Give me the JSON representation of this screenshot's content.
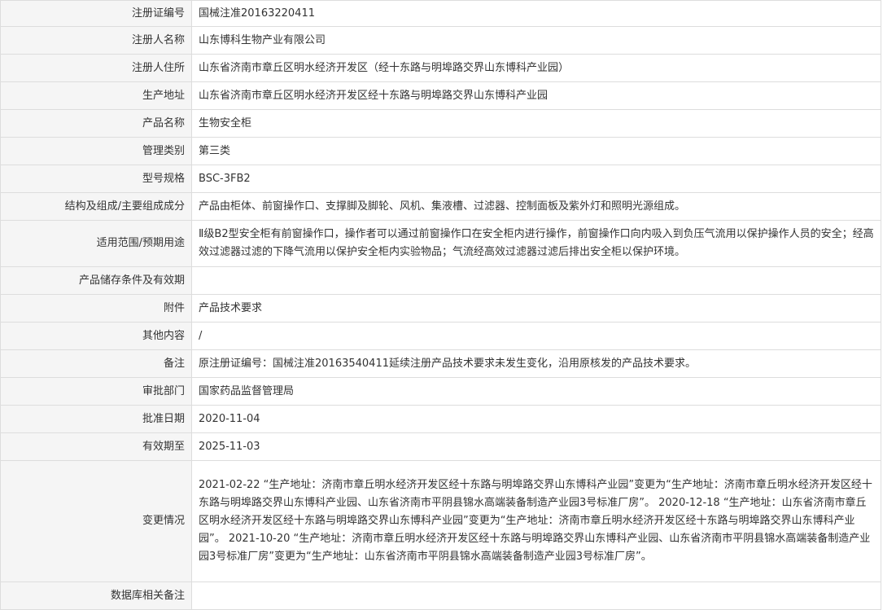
{
  "rows": [
    {
      "label": "注册证编号",
      "value": "国械注准20163220411"
    },
    {
      "label": "注册人名称",
      "value": "山东博科生物产业有限公司"
    },
    {
      "label": "注册人住所",
      "value": "山东省济南市章丘区明水经济开发区（经十东路与明埠路交界山东博科产业园）"
    },
    {
      "label": "生产地址",
      "value": "山东省济南市章丘区明水经济开发区经十东路与明埠路交界山东博科产业园"
    },
    {
      "label": "产品名称",
      "value": "生物安全柜"
    },
    {
      "label": "管理类别",
      "value": "第三类"
    },
    {
      "label": "型号规格",
      "value": "BSC-3FB2"
    },
    {
      "label": "结构及组成/主要组成成分",
      "value": "产品由柜体、前窗操作口、支撑脚及脚轮、风机、集液槽、过滤器、控制面板及紫外灯和照明光源组成。"
    },
    {
      "label": "适用范围/预期用途",
      "value": "Ⅱ级B2型安全柜有前窗操作口，操作者可以通过前窗操作口在安全柜内进行操作，前窗操作口向内吸入到负压气流用以保护操作人员的安全；经高效过滤器过滤的下降气流用以保护安全柜内实验物品；气流经高效过滤器过滤后排出安全柜以保护环境。"
    },
    {
      "label": "产品储存条件及有效期",
      "value": ""
    },
    {
      "label": "附件",
      "value": "产品技术要求"
    },
    {
      "label": "其他内容",
      "value": "/"
    },
    {
      "label": "备注",
      "value": "原注册证编号：国械注准20163540411延续注册产品技术要求未发生变化，沿用原核发的产品技术要求。"
    },
    {
      "label": "审批部门",
      "value": "国家药品监督管理局"
    },
    {
      "label": "批准日期",
      "value": "2020-11-04"
    },
    {
      "label": "有效期至",
      "value": "2025-11-03"
    },
    {
      "label": "变更情况",
      "value": "2021-02-22 “生产地址：济南市章丘明水经济开发区经十东路与明埠路交界山东博科产业园”变更为“生产地址：济南市章丘明水经济开发区经十东路与明埠路交界山东博科产业园、山东省济南市平阴县锦水高端装备制造产业园3号标准厂房”。 2020-12-18 “生产地址：山东省济南市章丘区明水经济开发区经十东路与明埠路交界山东博科产业园”变更为“生产地址：济南市章丘明水经济开发区经十东路与明埠路交界山东博科产业园”。 2021-10-20 “生产地址：济南市章丘明水经济开发区经十东路与明埠路交界山东博科产业园、山东省济南市平阴县锦水高端装备制造产业园3号标准厂房”变更为“生产地址：山东省济南市平阴县锦水高端装备制造产业园3号标准厂房”。"
    },
    {
      "label": "数据库相关备注",
      "value": ""
    }
  ]
}
